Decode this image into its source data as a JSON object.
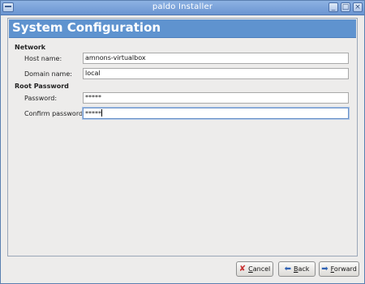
{
  "window": {
    "title": "paldo Installer",
    "controls": [
      "minimize-icon",
      "maximize-icon",
      "close-icon"
    ]
  },
  "page": {
    "title": "System Configuration"
  },
  "network": {
    "section_label": "Network",
    "host_label": "Host name:",
    "host_value": "amnons-virtualbox",
    "domain_label": "Domain name:",
    "domain_value": "local"
  },
  "root_password": {
    "section_label": "Root Password",
    "password_label": "Password:",
    "password_value": "*****",
    "confirm_label": "Confirm password:",
    "confirm_value": "*****"
  },
  "buttons": {
    "cancel_first": "C",
    "cancel_rest": "ancel",
    "back_first": "B",
    "back_rest": "ack",
    "forward_first": "F",
    "forward_rest": "orward"
  },
  "colors": {
    "header": "#5f93cf",
    "titlebar": "#7aa3da"
  }
}
